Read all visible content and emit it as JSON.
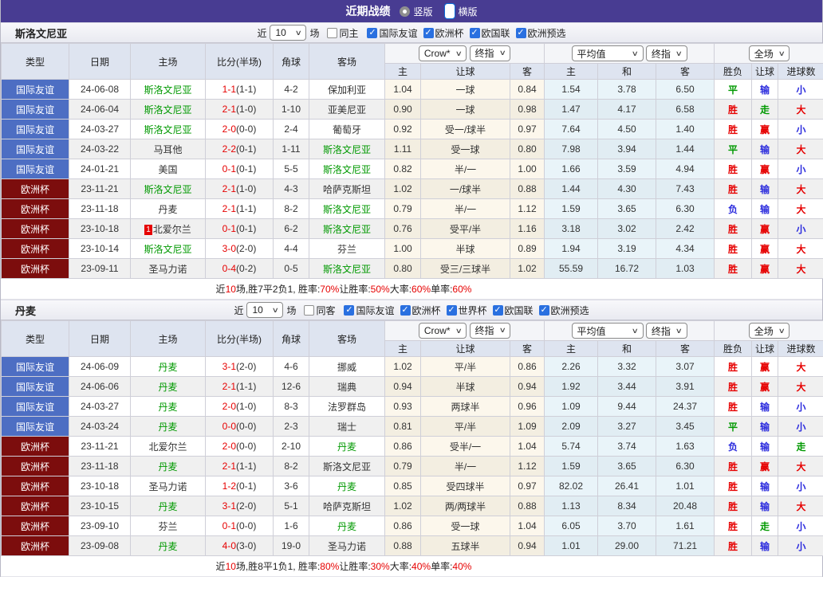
{
  "topbar": {
    "title": "近期战绩",
    "radios": [
      {
        "label": "竖版",
        "selected": false
      },
      {
        "label": "横版",
        "selected": true
      }
    ]
  },
  "colors": {
    "topbar_purple": "#483C92",
    "league_friendly_blue": "#4D6EC3",
    "league_eurocup_maroon": "#7C0D0D",
    "result_red": "#E60000",
    "result_blue": "#2B2BDD",
    "result_green": "#009900",
    "focus_team_green": "#009900",
    "odds_bg_cream": "#FCF7EC",
    "avg_bg_blue": "#E9F4F9",
    "header_bg": "#DEE4F0"
  },
  "table_header": {
    "cols": [
      "类型",
      "日期",
      "主场",
      "比分(半场)",
      "角球",
      "客场"
    ],
    "dropdowns": {
      "crow": "Crow*",
      "final1": "终指",
      "avg": "平均值",
      "final2": "终指",
      "scope": "全场"
    },
    "sub": [
      "主",
      "让球",
      "客",
      "主",
      "和",
      "客",
      "胜负",
      "让球",
      "进球数"
    ]
  },
  "sections": [
    {
      "team": "斯洛文尼亚",
      "filter": {
        "near_label": "近",
        "matches": "10",
        "field_label": "场",
        "same_label": "同主",
        "same_checked": false,
        "leagues": [
          {
            "label": "国际友谊",
            "checked": true
          },
          {
            "label": "欧洲杯",
            "checked": true
          },
          {
            "label": "欧国联",
            "checked": true
          },
          {
            "label": "欧洲预选",
            "checked": true
          }
        ]
      },
      "rows": [
        {
          "league": "国际友谊",
          "lc": "blue",
          "date": "24-06-08",
          "home": "斯洛文尼亚",
          "hg": true,
          "hb": "",
          "score": "1-1",
          "half": "(1-1)",
          "corner": "4-2",
          "away": "保加利亚",
          "ag": false,
          "o1": "1.04",
          "hcp": "一球",
          "o2": "0.84",
          "m1": "1.54",
          "m2": "3.78",
          "m3": "6.50",
          "r1": [
            "平",
            "g"
          ],
          "r2": [
            "输",
            "b"
          ],
          "r3": [
            "小",
            "b"
          ]
        },
        {
          "league": "国际友谊",
          "lc": "blue",
          "date": "24-06-04",
          "home": "斯洛文尼亚",
          "hg": true,
          "hb": "",
          "score": "2-1",
          "half": "(1-0)",
          "corner": "1-10",
          "away": "亚美尼亚",
          "ag": false,
          "o1": "0.90",
          "hcp": "一球",
          "o2": "0.98",
          "m1": "1.47",
          "m2": "4.17",
          "m3": "6.58",
          "r1": [
            "胜",
            "r"
          ],
          "r2": [
            "走",
            "g"
          ],
          "r3": [
            "大",
            "r"
          ]
        },
        {
          "league": "国际友谊",
          "lc": "blue",
          "date": "24-03-27",
          "home": "斯洛文尼亚",
          "hg": true,
          "hb": "",
          "score": "2-0",
          "half": "(0-0)",
          "corner": "2-4",
          "away": "葡萄牙",
          "ag": false,
          "o1": "0.92",
          "hcp": "受一/球半",
          "o2": "0.97",
          "m1": "7.64",
          "m2": "4.50",
          "m3": "1.40",
          "r1": [
            "胜",
            "r"
          ],
          "r2": [
            "赢",
            "r"
          ],
          "r3": [
            "小",
            "b"
          ]
        },
        {
          "league": "国际友谊",
          "lc": "blue",
          "date": "24-03-22",
          "home": "马耳他",
          "hg": false,
          "hb": "",
          "score": "2-2",
          "half": "(0-1)",
          "corner": "1-11",
          "away": "斯洛文尼亚",
          "ag": true,
          "o1": "1.11",
          "hcp": "受一球",
          "o2": "0.80",
          "m1": "7.98",
          "m2": "3.94",
          "m3": "1.44",
          "r1": [
            "平",
            "g"
          ],
          "r2": [
            "输",
            "b"
          ],
          "r3": [
            "大",
            "r"
          ]
        },
        {
          "league": "国际友谊",
          "lc": "blue",
          "date": "24-01-21",
          "home": "美国",
          "hg": false,
          "hb": "",
          "score": "0-1",
          "half": "(0-1)",
          "corner": "5-5",
          "away": "斯洛文尼亚",
          "ag": true,
          "o1": "0.82",
          "hcp": "半/一",
          "o2": "1.00",
          "m1": "1.66",
          "m2": "3.59",
          "m3": "4.94",
          "r1": [
            "胜",
            "r"
          ],
          "r2": [
            "赢",
            "r"
          ],
          "r3": [
            "小",
            "b"
          ]
        },
        {
          "league": "欧洲杯",
          "lc": "maroon",
          "date": "23-11-21",
          "home": "斯洛文尼亚",
          "hg": true,
          "hb": "",
          "score": "2-1",
          "half": "(1-0)",
          "corner": "4-3",
          "away": "哈萨克斯坦",
          "ag": false,
          "o1": "1.02",
          "hcp": "一/球半",
          "o2": "0.88",
          "m1": "1.44",
          "m2": "4.30",
          "m3": "7.43",
          "r1": [
            "胜",
            "r"
          ],
          "r2": [
            "输",
            "b"
          ],
          "r3": [
            "大",
            "r"
          ]
        },
        {
          "league": "欧洲杯",
          "lc": "maroon",
          "date": "23-11-18",
          "home": "丹麦",
          "hg": false,
          "hb": "",
          "score": "2-1",
          "half": "(1-1)",
          "corner": "8-2",
          "away": "斯洛文尼亚",
          "ag": true,
          "o1": "0.79",
          "hcp": "半/一",
          "o2": "1.12",
          "m1": "1.59",
          "m2": "3.65",
          "m3": "6.30",
          "r1": [
            "负",
            "b"
          ],
          "r2": [
            "输",
            "b"
          ],
          "r3": [
            "大",
            "r"
          ]
        },
        {
          "league": "欧洲杯",
          "lc": "maroon",
          "date": "23-10-18",
          "home": "北爱尔兰",
          "hg": false,
          "hb": "1",
          "score": "0-1",
          "half": "(0-1)",
          "corner": "6-2",
          "away": "斯洛文尼亚",
          "ag": true,
          "o1": "0.76",
          "hcp": "受平/半",
          "o2": "1.16",
          "m1": "3.18",
          "m2": "3.02",
          "m3": "2.42",
          "r1": [
            "胜",
            "r"
          ],
          "r2": [
            "赢",
            "r"
          ],
          "r3": [
            "小",
            "b"
          ]
        },
        {
          "league": "欧洲杯",
          "lc": "maroon",
          "date": "23-10-14",
          "home": "斯洛文尼亚",
          "hg": true,
          "hb": "",
          "score": "3-0",
          "half": "(2-0)",
          "corner": "4-4",
          "away": "芬兰",
          "ag": false,
          "o1": "1.00",
          "hcp": "半球",
          "o2": "0.89",
          "m1": "1.94",
          "m2": "3.19",
          "m3": "4.34",
          "r1": [
            "胜",
            "r"
          ],
          "r2": [
            "赢",
            "r"
          ],
          "r3": [
            "大",
            "r"
          ]
        },
        {
          "league": "欧洲杯",
          "lc": "maroon",
          "date": "23-09-11",
          "home": "圣马力诺",
          "hg": false,
          "hb": "",
          "score": "0-4",
          "half": "(0-2)",
          "corner": "0-5",
          "away": "斯洛文尼亚",
          "ag": true,
          "o1": "0.80",
          "hcp": "受三/三球半",
          "o2": "1.02",
          "m1": "55.59",
          "m2": "16.72",
          "m3": "1.03",
          "r1": [
            "胜",
            "r"
          ],
          "r2": [
            "赢",
            "r"
          ],
          "r3": [
            "大",
            "r"
          ]
        }
      ],
      "summary_parts": [
        {
          "t": "近",
          "c": "k"
        },
        {
          "t": "10",
          "c": "r"
        },
        {
          "t": "场,胜7平2负1, 胜率:",
          "c": "k"
        },
        {
          "t": "70%",
          "c": "r"
        },
        {
          "t": " 让胜率:",
          "c": "k"
        },
        {
          "t": "50%",
          "c": "r"
        },
        {
          "t": " 大率:",
          "c": "k"
        },
        {
          "t": "60%",
          "c": "r"
        },
        {
          "t": " 单率:",
          "c": "k"
        },
        {
          "t": "60%",
          "c": "r"
        }
      ]
    },
    {
      "team": "丹麦",
      "filter": {
        "near_label": "近",
        "matches": "10",
        "field_label": "场",
        "same_label": "同客",
        "same_checked": false,
        "leagues": [
          {
            "label": "国际友谊",
            "checked": true
          },
          {
            "label": "欧洲杯",
            "checked": true
          },
          {
            "label": "世界杯",
            "checked": true
          },
          {
            "label": "欧国联",
            "checked": true
          },
          {
            "label": "欧洲预选",
            "checked": true
          }
        ]
      },
      "rows": [
        {
          "league": "国际友谊",
          "lc": "blue",
          "date": "24-06-09",
          "home": "丹麦",
          "hg": true,
          "hb": "",
          "score": "3-1",
          "half": "(2-0)",
          "corner": "4-6",
          "away": "挪威",
          "ag": false,
          "o1": "1.02",
          "hcp": "平/半",
          "o2": "0.86",
          "m1": "2.26",
          "m2": "3.32",
          "m3": "3.07",
          "r1": [
            "胜",
            "r"
          ],
          "r2": [
            "赢",
            "r"
          ],
          "r3": [
            "大",
            "r"
          ]
        },
        {
          "league": "国际友谊",
          "lc": "blue",
          "date": "24-06-06",
          "home": "丹麦",
          "hg": true,
          "hb": "",
          "score": "2-1",
          "half": "(1-1)",
          "corner": "12-6",
          "away": "瑞典",
          "ag": false,
          "o1": "0.94",
          "hcp": "半球",
          "o2": "0.94",
          "m1": "1.92",
          "m2": "3.44",
          "m3": "3.91",
          "r1": [
            "胜",
            "r"
          ],
          "r2": [
            "赢",
            "r"
          ],
          "r3": [
            "大",
            "r"
          ]
        },
        {
          "league": "国际友谊",
          "lc": "blue",
          "date": "24-03-27",
          "home": "丹麦",
          "hg": true,
          "hb": "",
          "score": "2-0",
          "half": "(1-0)",
          "corner": "8-3",
          "away": "法罗群岛",
          "ag": false,
          "o1": "0.93",
          "hcp": "两球半",
          "o2": "0.96",
          "m1": "1.09",
          "m2": "9.44",
          "m3": "24.37",
          "r1": [
            "胜",
            "r"
          ],
          "r2": [
            "输",
            "b"
          ],
          "r3": [
            "小",
            "b"
          ]
        },
        {
          "league": "国际友谊",
          "lc": "blue",
          "date": "24-03-24",
          "home": "丹麦",
          "hg": true,
          "hb": "",
          "score": "0-0",
          "half": "(0-0)",
          "corner": "2-3",
          "away": "瑞士",
          "ag": false,
          "o1": "0.81",
          "hcp": "平/半",
          "o2": "1.09",
          "m1": "2.09",
          "m2": "3.27",
          "m3": "3.45",
          "r1": [
            "平",
            "g"
          ],
          "r2": [
            "输",
            "b"
          ],
          "r3": [
            "小",
            "b"
          ]
        },
        {
          "league": "欧洲杯",
          "lc": "maroon",
          "date": "23-11-21",
          "home": "北爱尔兰",
          "hg": false,
          "hb": "",
          "score": "2-0",
          "half": "(0-0)",
          "corner": "2-10",
          "away": "丹麦",
          "ag": true,
          "o1": "0.86",
          "hcp": "受半/一",
          "o2": "1.04",
          "m1": "5.74",
          "m2": "3.74",
          "m3": "1.63",
          "r1": [
            "负",
            "b"
          ],
          "r2": [
            "输",
            "b"
          ],
          "r3": [
            "走",
            "g"
          ]
        },
        {
          "league": "欧洲杯",
          "lc": "maroon",
          "date": "23-11-18",
          "home": "丹麦",
          "hg": true,
          "hb": "",
          "score": "2-1",
          "half": "(1-1)",
          "corner": "8-2",
          "away": "斯洛文尼亚",
          "ag": false,
          "o1": "0.79",
          "hcp": "半/一",
          "o2": "1.12",
          "m1": "1.59",
          "m2": "3.65",
          "m3": "6.30",
          "r1": [
            "胜",
            "r"
          ],
          "r2": [
            "赢",
            "r"
          ],
          "r3": [
            "大",
            "r"
          ]
        },
        {
          "league": "欧洲杯",
          "lc": "maroon",
          "date": "23-10-18",
          "home": "圣马力诺",
          "hg": false,
          "hb": "",
          "score": "1-2",
          "half": "(0-1)",
          "corner": "3-6",
          "away": "丹麦",
          "ag": true,
          "o1": "0.85",
          "hcp": "受四球半",
          "o2": "0.97",
          "m1": "82.02",
          "m2": "26.41",
          "m3": "1.01",
          "r1": [
            "胜",
            "r"
          ],
          "r2": [
            "输",
            "b"
          ],
          "r3": [
            "小",
            "b"
          ]
        },
        {
          "league": "欧洲杯",
          "lc": "maroon",
          "date": "23-10-15",
          "home": "丹麦",
          "hg": true,
          "hb": "",
          "score": "3-1",
          "half": "(2-0)",
          "corner": "5-1",
          "away": "哈萨克斯坦",
          "ag": false,
          "o1": "1.02",
          "hcp": "两/两球半",
          "o2": "0.88",
          "m1": "1.13",
          "m2": "8.34",
          "m3": "20.48",
          "r1": [
            "胜",
            "r"
          ],
          "r2": [
            "输",
            "b"
          ],
          "r3": [
            "大",
            "r"
          ]
        },
        {
          "league": "欧洲杯",
          "lc": "maroon",
          "date": "23-09-10",
          "home": "芬兰",
          "hg": false,
          "hb": "",
          "score": "0-1",
          "half": "(0-0)",
          "corner": "1-6",
          "away": "丹麦",
          "ag": true,
          "o1": "0.86",
          "hcp": "受一球",
          "o2": "1.04",
          "m1": "6.05",
          "m2": "3.70",
          "m3": "1.61",
          "r1": [
            "胜",
            "r"
          ],
          "r2": [
            "走",
            "g"
          ],
          "r3": [
            "小",
            "b"
          ]
        },
        {
          "league": "欧洲杯",
          "lc": "maroon",
          "date": "23-09-08",
          "home": "丹麦",
          "hg": true,
          "hb": "",
          "score": "4-0",
          "half": "(3-0)",
          "corner": "19-0",
          "away": "圣马力诺",
          "ag": false,
          "o1": "0.88",
          "hcp": "五球半",
          "o2": "0.94",
          "m1": "1.01",
          "m2": "29.00",
          "m3": "71.21",
          "r1": [
            "胜",
            "r"
          ],
          "r2": [
            "输",
            "b"
          ],
          "r3": [
            "小",
            "b"
          ]
        }
      ],
      "summary_parts": [
        {
          "t": "近",
          "c": "k"
        },
        {
          "t": "10",
          "c": "r"
        },
        {
          "t": "场,胜8平1负1, 胜率:",
          "c": "k"
        },
        {
          "t": "80%",
          "c": "r"
        },
        {
          "t": " 让胜率:",
          "c": "k"
        },
        {
          "t": "30%",
          "c": "r"
        },
        {
          "t": " 大率:",
          "c": "k"
        },
        {
          "t": "40%",
          "c": "r"
        },
        {
          "t": " 单率:",
          "c": "k"
        },
        {
          "t": "40%",
          "c": "r"
        }
      ]
    }
  ]
}
